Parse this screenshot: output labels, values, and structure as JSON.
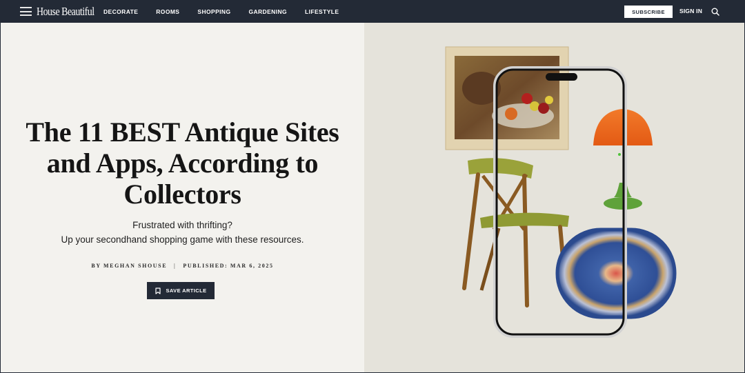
{
  "nav": {
    "brand": "House Beautiful",
    "links": [
      "DECORATE",
      "ROOMS",
      "SHOPPING",
      "GARDENING",
      "LIFESTYLE"
    ],
    "subscribe_label": "SUBSCRIBE",
    "signin_label": "SIGN IN",
    "menu_icon": "hamburger-icon",
    "search_icon": "search-icon"
  },
  "article": {
    "title": "The 11 BEST Antique Sites and Apps, According to Collectors",
    "dek_line1": "Frustrated with thrifting?",
    "dek_line2": "Up your secondhand shopping game with these resources.",
    "byline": "BY MEGHAN SHOUSE",
    "byline_separator": "|",
    "published": "PUBLISHED: MAR 6, 2025",
    "save_label": "SAVE ARTICLE",
    "save_icon": "bookmark-icon"
  },
  "hero": {
    "description": "Collage of antique items: framed still-life painting, mid-century green chair, orange mushroom lamp, oval Persian rug, overlaid with a smartphone outline",
    "colors": {
      "background": "#e5e3db",
      "lamp_shade": "#ec6a1e",
      "lamp_base": "#5fa23a",
      "chair_fabric": "#9aa23a",
      "chair_wood": "#8a5a22",
      "rug_blue": "#2f4f96",
      "frame_gold": "#e2d3b0"
    }
  },
  "theme": {
    "nav_bg": "#232a36",
    "left_bg": "#f3f2ee",
    "text": "#151515"
  }
}
